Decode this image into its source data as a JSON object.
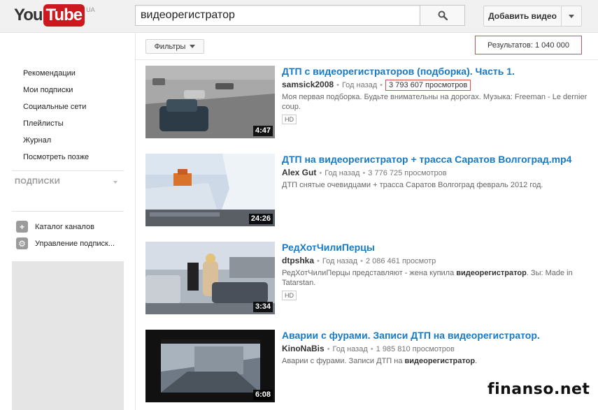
{
  "masthead": {
    "logo_you": "You",
    "logo_tube": "Tube",
    "logo_region": "UA",
    "search_value": "видеорегистратор",
    "upload_label": "Добавить видео"
  },
  "guide": {
    "items": [
      "Рекомендации",
      "Мои подписки",
      "Социальные сети",
      "Плейлисты",
      "Журнал",
      "Посмотреть позже"
    ],
    "subscriptions_heading": "ПОДПИСКИ",
    "channel_catalog": "Каталог каналов",
    "manage_subscriptions": "Управление подписк..."
  },
  "filters": {
    "label": "Фильтры",
    "results": "Результатов: 1 040 000"
  },
  "results": [
    {
      "title": "ДТП с видеорегистраторов (подборка). Часть 1.",
      "channel": "samsick2008",
      "age": "Год назад",
      "views": "3 793 607 просмотров",
      "description": "Моя первая подборка. Будьте внимательны на дорогах. Музыка: Freeman - Le dernier coup.",
      "duration": "4:47",
      "badge": "HD"
    },
    {
      "title": "ДТП на видеорегистратор + трасса Саратов Волгоград.mp4",
      "channel": "Alex Gut",
      "age": "Год назад",
      "views": "3 776 725 просмотров",
      "description": "ДТП снятые очевидцами + трасса Саратов Волгоград февраль 2012 год.",
      "duration": "24:26"
    },
    {
      "title": "РедХотЧилиПерцы",
      "channel": "dtpshka",
      "age": "Год назад",
      "views": "2 086 461 просмотр",
      "description_pre": "РедХотЧилиПерцы представляют - жена купила ",
      "description_bold": "видеорегистратор",
      "description_post": ". Зы: Made in Tatarstan.",
      "duration": "3:34",
      "badge": "HD"
    },
    {
      "title": "Аварии с фурами. Записи ДТП на видеорегистратор.",
      "channel": "KinoNaBis",
      "age": "Год назад",
      "views": "1 985 810 просмотров",
      "description_pre": "Аварии с фурами. Записи ДТП на ",
      "description_bold": "видеорегистратор",
      "description_post": ".",
      "duration": "6:08"
    }
  ],
  "watermark": "finanso.net",
  "colors": {
    "brand_red": "#cc181e",
    "link_blue": "#167ac6",
    "highlight_red": "#e24b4b"
  }
}
